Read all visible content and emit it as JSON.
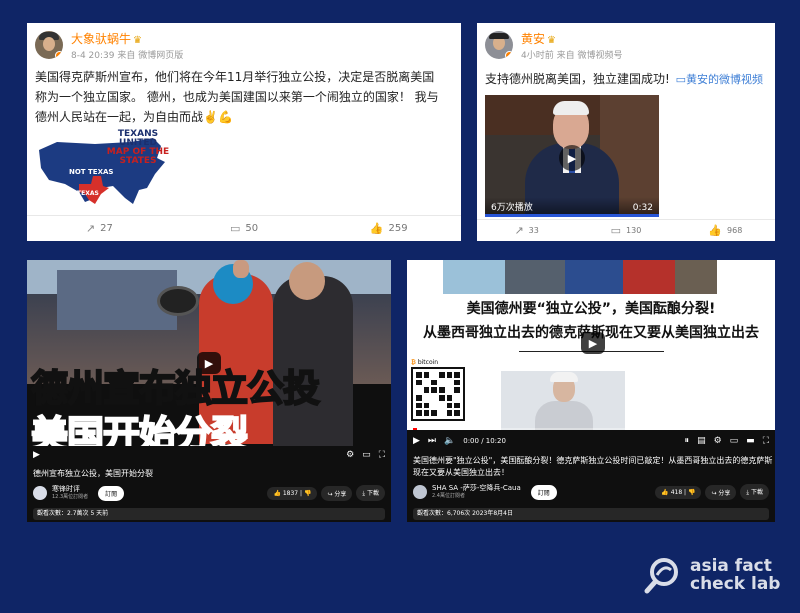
{
  "weibo1": {
    "username": "大象驮蜗牛",
    "meta": "8-4 20:39 来自 微博网页版",
    "text_lines": [
      "美国得克萨斯州宣布，他们将在今年11月举行独立公投，决定是否脱离美国",
      "称为一个独立国家。 德州，也成为美国建国以来第一个闹独立的国家！ 我与",
      "德州人民站在一起，为自由而战✌️💪"
    ],
    "map": {
      "title_1": "TEXANS UNITED",
      "title_2": "MAP OF THE STATES",
      "label_not_texas": "NOT TEXAS",
      "label_texas": "TEXAS"
    },
    "repost_count": "27",
    "comment_count": "50",
    "like_count": "259"
  },
  "weibo2": {
    "username": "黄安",
    "meta": "4小时前 来自 微博视频号",
    "text": "支持德州脱离美国，独立建国成功!",
    "video_link": "黄安的微博视频",
    "video_views": "6万次播放",
    "video_duration": "0:32",
    "repost_count": "33",
    "comment_count": "130",
    "like_count": "968"
  },
  "yt1": {
    "overlay_line1": "德州宣布独立公投",
    "overlay_line2": "美国开始分裂",
    "title": "德州宣布独立公投，美国开始分裂",
    "channel": "寒锋时评",
    "subscribers": "12.3萬位訂閱者",
    "subscribe_label": "訂閱",
    "like_count": "1837",
    "share_label": "分享",
    "download_label": "下載",
    "views": "觀看次數：2.7萬次  5 天前"
  },
  "yt2": {
    "headline_1": "美国德州要“独立公投”，美国酝酿分裂!",
    "headline_2": "从墨西哥独立出去的德克萨斯现在又要从美国独立出去",
    "bitcoin_label": "bitcoin",
    "time": "0:00 / 10:20",
    "title": "美国德州要\"独立公投\"，美国酝酿分裂！德克萨斯独立公投时间已敲定！从墨西哥独立出去的德克萨斯现在又要从美国独立出去！",
    "channel": "SHA SA -萨莎-空降兵-Caua",
    "subscribers": "2.4萬位訂閱者",
    "subscribe_label": "訂閱",
    "like_count": "418",
    "share_label": "分享",
    "download_label": "下載",
    "views": "觀看次數：6,706次  2023年8月4日"
  },
  "logo": {
    "line1": "asia fact",
    "line2": "check lab"
  },
  "colors": {
    "background": "#0f2566",
    "weibo_name": "#ff8200",
    "youtube_bg": "#0f0f0f",
    "yt_red": "#ff0000"
  }
}
